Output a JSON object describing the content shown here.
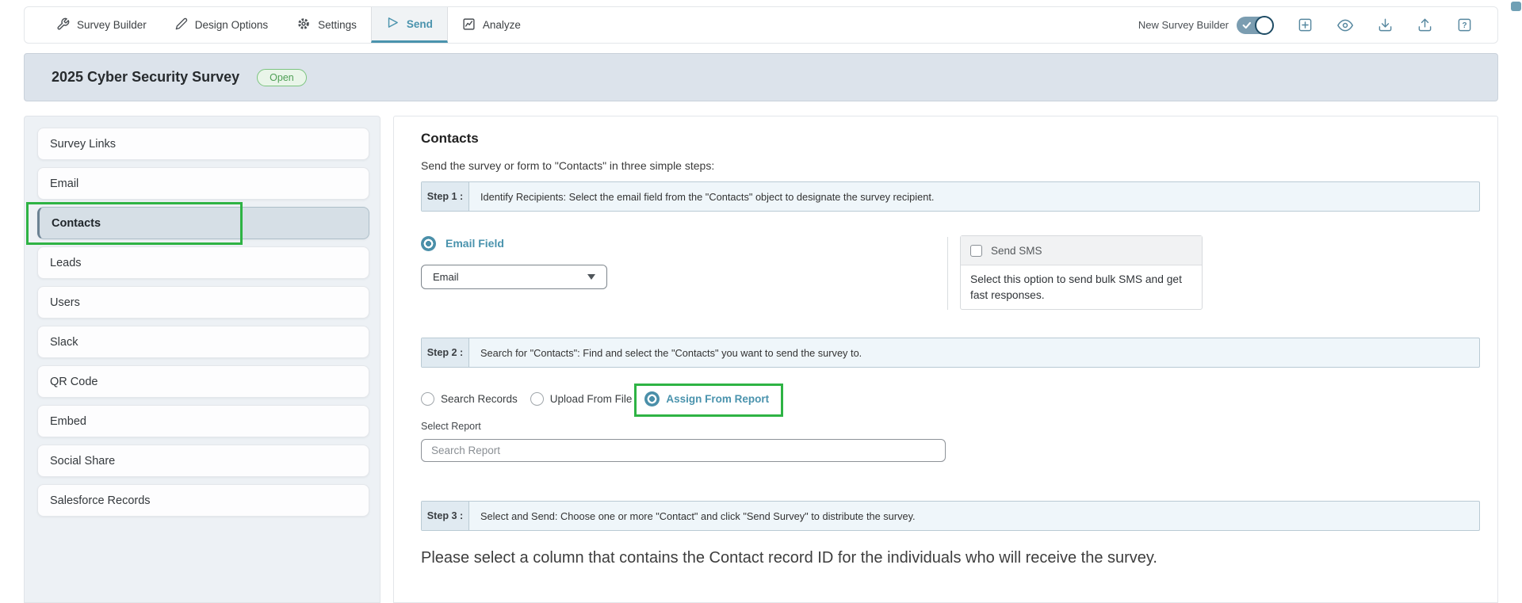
{
  "colors": {
    "accent_teal": "#4a93ad",
    "annotation_green": "#2eb344",
    "badge_green_text": "#4f9f55",
    "titlebar_bg": "#dce3eb",
    "selected_item_bg": "#d6dfe6",
    "stepbar_bg": "#eff6fa"
  },
  "nav": {
    "tabs": [
      {
        "label": "Survey Builder",
        "icon": "wrench-icon",
        "active": false
      },
      {
        "label": "Design Options",
        "icon": "pen-icon",
        "active": false
      },
      {
        "label": "Settings",
        "icon": "gear-icon",
        "active": false
      },
      {
        "label": "Send",
        "icon": "send-icon",
        "active": true
      },
      {
        "label": "Analyze",
        "icon": "chart-icon",
        "active": false
      }
    ],
    "toggle": {
      "label": "New Survey Builder",
      "state": "on"
    },
    "action_icons": [
      "add-icon",
      "preview-eye-icon",
      "download-icon",
      "export-icon",
      "help-icon"
    ]
  },
  "title": {
    "text": "2025 Cyber Security Survey",
    "status": "Open"
  },
  "sidebar": {
    "items": [
      {
        "label": "Survey Links"
      },
      {
        "label": "Email"
      },
      {
        "label": "Contacts"
      },
      {
        "label": "Leads"
      },
      {
        "label": "Users"
      },
      {
        "label": "Slack"
      },
      {
        "label": "QR Code"
      },
      {
        "label": "Embed"
      },
      {
        "label": "Social Share"
      },
      {
        "label": "Salesforce Records"
      }
    ],
    "selected": "Contacts"
  },
  "main": {
    "heading": "Contacts",
    "intro": "Send the survey or form to \"Contacts\" in three simple steps:",
    "steps": [
      {
        "label": "Step 1 :",
        "text": "Identify Recipients: Select the email field from the \"Contacts\" object to designate the survey recipient."
      },
      {
        "label": "Step 2 :",
        "text": "Search for \"Contacts\": Find and select the \"Contacts\" you want to send the survey to."
      },
      {
        "label": "Step 3 :",
        "text": "Select and Send: Choose one or more \"Contact\" and click \"Send Survey\" to distribute the survey."
      }
    ],
    "email_field": {
      "label": "Email Field",
      "value": "Email",
      "selected": true
    },
    "sms": {
      "label": "Send SMS",
      "checked": false,
      "description": "Select this option to send bulk SMS and get fast responses."
    },
    "search_options": [
      "Search Records",
      "Upload From File",
      "Assign From Report"
    ],
    "search_selected": "Assign From Report",
    "report": {
      "label": "Select Report",
      "placeholder": "Search Report"
    },
    "message": "Please select a column that contains the Contact record ID for the individuals who will receive the survey."
  }
}
